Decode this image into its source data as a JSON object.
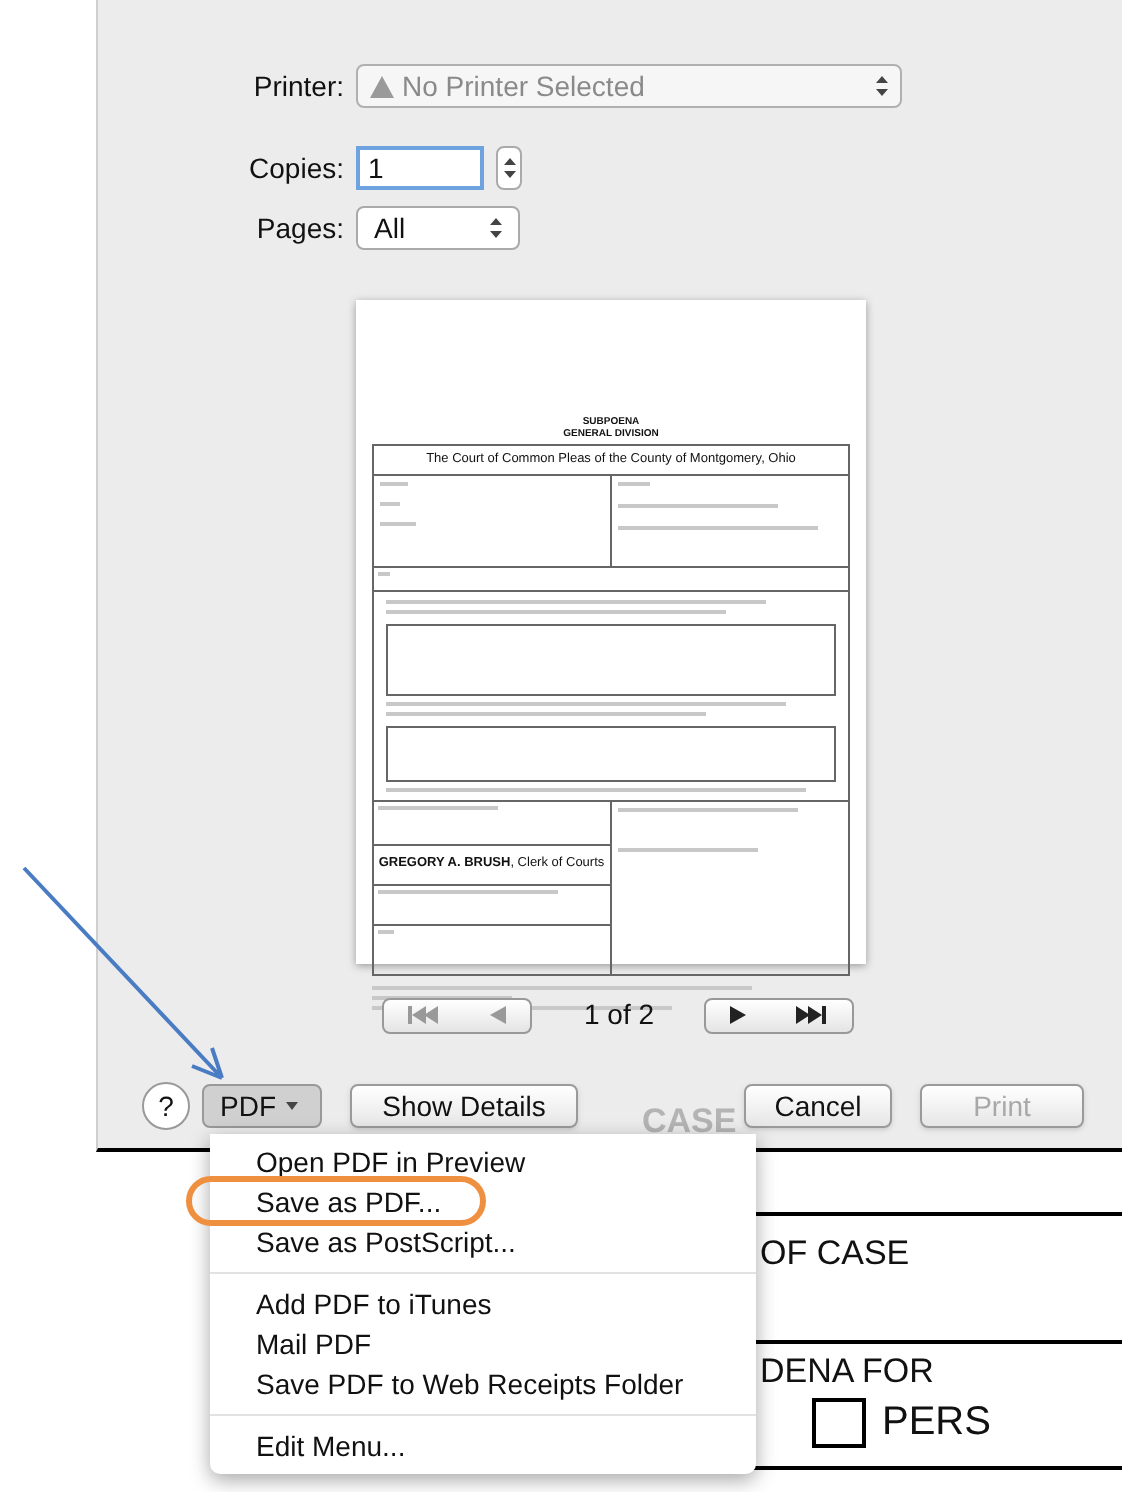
{
  "print_dialog": {
    "printer": {
      "label": "Printer:",
      "value": "No Printer Selected",
      "warning": true
    },
    "copies": {
      "label": "Copies:",
      "value": "1",
      "focused": true
    },
    "pages": {
      "label": "Pages:",
      "value": "All"
    },
    "preview": {
      "title": "SUBPOENA",
      "subtitle": "GENERAL DIVISION",
      "court": "The Court of Common Pleas of the County of Montgomery, Ohio",
      "clerk": "**GREGORY A. BRUSH**, Clerk of Courts"
    },
    "page_indicator": "1 of 2",
    "help": "?",
    "pdf_button": {
      "label": "PDF",
      "expanded": true
    },
    "show_details": {
      "label": "Show Details"
    },
    "cancel": {
      "label": "Cancel",
      "disabled": false
    },
    "print": {
      "label": "Print",
      "disabled": true
    }
  },
  "pdf_menu": {
    "groups": [
      {
        "items": [
          {
            "label": "Open PDF in Preview",
            "circled": false
          },
          {
            "label": "Save as PDF...",
            "circled": true
          },
          {
            "label": "Save as PostScript...",
            "circled": false
          }
        ]
      },
      {
        "items": [
          {
            "label": "Add PDF to iTunes",
            "circled": false
          },
          {
            "label": "Mail PDF",
            "circled": false
          },
          {
            "label": "Save PDF to Web Receipts Folder",
            "circled": false
          }
        ]
      },
      {
        "items": [
          {
            "label": "Edit Menu...",
            "circled": false
          }
        ]
      }
    ]
  },
  "background_document": {
    "behind_dialog": "CASE",
    "case_label": "OF CASE",
    "subpoena_label": "DENA FOR",
    "checkbox_label": "PERS",
    "checkbox_checked": false
  }
}
